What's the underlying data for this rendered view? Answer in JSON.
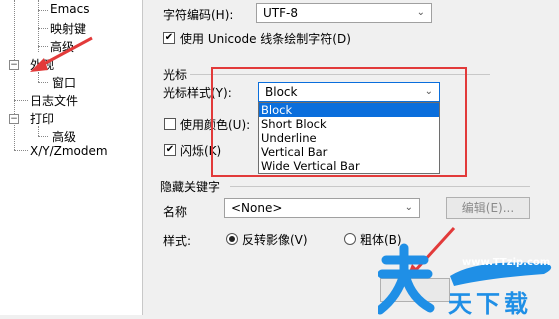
{
  "tree": {
    "items": [
      {
        "label": "Emacs"
      },
      {
        "label": "映射键"
      },
      {
        "label": "高级"
      },
      {
        "label": "外观"
      },
      {
        "label": "窗口"
      },
      {
        "label": "日志文件"
      },
      {
        "label": "打印"
      },
      {
        "label": "高级"
      },
      {
        "label": "X/Y/Zmodem"
      }
    ],
    "expander_minus": "−"
  },
  "encoding": {
    "label": "字符编码(H):",
    "value": "UTF-8"
  },
  "unicode_line": {
    "label": "使用 Unicode 线条绘制字符(D)",
    "checked": true
  },
  "cursor_group": {
    "title": "光标",
    "style_label": "光标样式(Y):",
    "style_value": "Block",
    "options": [
      "Block",
      "Short Block",
      "Underline",
      "Vertical Bar",
      "Wide Vertical Bar"
    ],
    "selected_index": 0,
    "use_color_label": "使用颜色(U):",
    "use_color_checked": false,
    "blink_label": "闪烁(K)",
    "blink_checked": true
  },
  "hide_keyword": {
    "title": "隐藏关键字",
    "name_label": "名称",
    "name_value": "<None>",
    "edit_button": "编辑(E)...",
    "style_label": "样式:",
    "radio_reverse": "反转影像(V)",
    "radio_bold": "粗体(B)",
    "selected": "reverse"
  },
  "watermark": {
    "url": "www.TTzip.com",
    "text": "天下载"
  },
  "colors": {
    "highlight": "#0a6edc",
    "annotation_red": "#e23a3a",
    "watermark_blue": "#1f8fe6"
  },
  "glyphs": {
    "arrow": "⌄",
    "check": "✔"
  }
}
